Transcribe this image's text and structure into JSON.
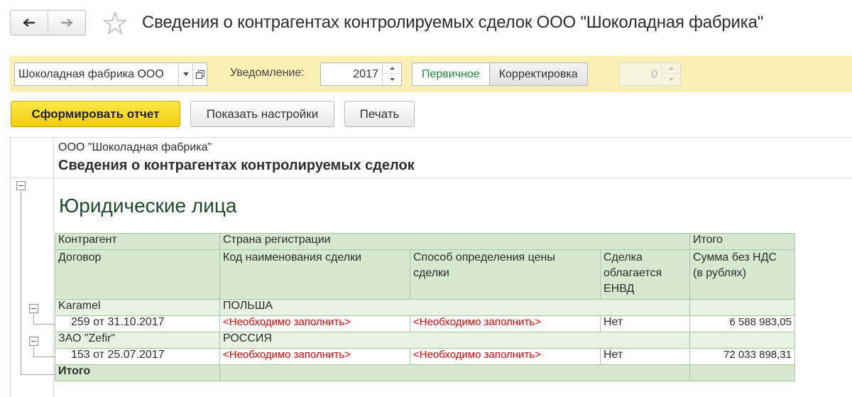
{
  "window": {
    "title": "Сведения о контрагентах контролируемых сделок ООО \"Шоколадная фабрика\""
  },
  "params": {
    "organization": "Шоколадная фабрика ООО",
    "notice_label": "Уведомление:",
    "year": "2017",
    "toggle_primary": "Первичное",
    "toggle_correction": "Корректировка",
    "correction_number": "0"
  },
  "actions": {
    "generate": "Сформировать отчет",
    "settings": "Показать настройки",
    "print": "Печать"
  },
  "report": {
    "org": "ООО \"Шоколадная фабрика\"",
    "title": "Сведения о контрагентах контролируемых сделок",
    "section": "Юридические лица",
    "headers": {
      "counterparty": "Контрагент",
      "country": "Страна регистрации",
      "total": "Итого",
      "contract": "Договор",
      "deal_code": "Код наименования сделки",
      "price_method_1": "Способ определения цены",
      "price_method_2": "сделки",
      "envd_1": "Сделка",
      "envd_2": "облагается",
      "envd_3": "ЕНВД",
      "sum_1": "Сумма без НДС",
      "sum_2": "(в рублях)"
    },
    "rows": [
      {
        "counterparty": "Karamel",
        "country": "ПОЛЬША",
        "contract": "259 от 31.10.2017",
        "deal_code": "<Необходимо заполнить>",
        "price_method": "<Необходимо заполнить>",
        "envd": "Нет",
        "sum": "6 588 983,05"
      },
      {
        "counterparty": "ЗАО \"Zefir\"",
        "country": "РОССИЯ",
        "contract": "153 от 25.07.2017",
        "deal_code": "<Необходимо заполнить>",
        "price_method": "<Необходимо заполнить>",
        "envd": "Нет",
        "sum": "72 033 898,31"
      }
    ],
    "total_label": "Итого"
  },
  "icons": {
    "back": "arrow-left-icon",
    "forward": "arrow-right-icon",
    "favorite": "star-icon",
    "dropdown": "chevron-down-icon",
    "open": "open-form-icon",
    "collapse": "minus-box-icon"
  },
  "colors": {
    "param_bar": "#faf0b4",
    "primary_button": "#f6d520",
    "header_fill": "#d7e8d0",
    "group_fill": "#e8f2e3",
    "required_text": "#e00000",
    "active_toggle": "#1f8a3b"
  }
}
